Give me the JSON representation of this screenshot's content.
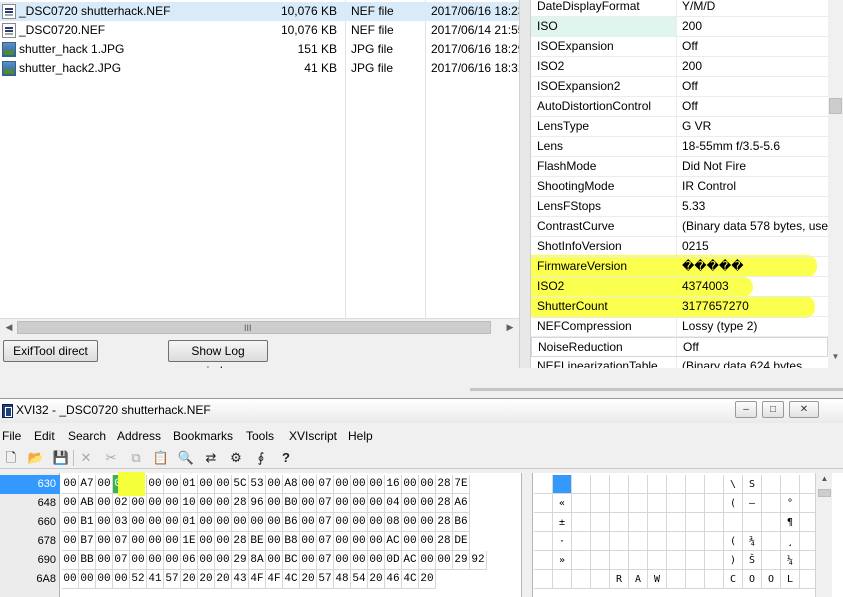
{
  "file_list": {
    "files": [
      {
        "name": "_DSC0720 shutterhack.NEF",
        "size": "10,076 KB",
        "type": "NEF file",
        "date": "2017/06/16 18:23",
        "icon": "nef-file-icon"
      },
      {
        "name": "_DSC0720.NEF",
        "size": "10,076 KB",
        "type": "NEF file",
        "date": "2017/06/14 21:55",
        "icon": "nef-file-icon"
      },
      {
        "name": "shutter_hack 1.JPG",
        "size": "151 KB",
        "type": "JPG file",
        "date": "2017/06/16 18:29",
        "icon": "jpg-file-icon"
      },
      {
        "name": "shutter_hack2.JPG",
        "size": "41 KB",
        "type": "JPG file",
        "date": "2017/06/16 18:31",
        "icon": "jpg-file-icon"
      }
    ],
    "scroll_grip": "III",
    "buttons": {
      "exiftool": "ExifTool direct",
      "show_log": "Show Log window"
    }
  },
  "exif": {
    "rows": [
      {
        "key": "DateDisplayFormat",
        "value": "Y/M/D"
      },
      {
        "key": "ISO",
        "value": "200"
      },
      {
        "key": "ISOExpansion",
        "value": "Off"
      },
      {
        "key": "ISO2",
        "value": "200"
      },
      {
        "key": "ISOExpansion2",
        "value": "Off"
      },
      {
        "key": "AutoDistortionControl",
        "value": "Off"
      },
      {
        "key": "LensType",
        "value": "G VR"
      },
      {
        "key": "Lens",
        "value": "18-55mm f/3.5-5.6"
      },
      {
        "key": "FlashMode",
        "value": "Did Not Fire"
      },
      {
        "key": "ShootingMode",
        "value": "IR Control"
      },
      {
        "key": "LensFStops",
        "value": "5.33"
      },
      {
        "key": "ContrastCurve",
        "value": "(Binary data 578 bytes, use -"
      },
      {
        "key": "ShotInfoVersion",
        "value": "0215"
      },
      {
        "key": "FirmwareVersion",
        "value": "�����"
      },
      {
        "key": "ISO2",
        "value": "4374003"
      },
      {
        "key": "ShutterCount",
        "value": "3177657270"
      },
      {
        "key": "NEFCompression",
        "value": "Lossy (type 2)"
      },
      {
        "key": "NoiseReduction",
        "value": "Off"
      },
      {
        "key": "NEFLinearizationTable",
        "value": "(Binary data 624 bytes"
      }
    ],
    "highlight_color": "#fbff3a"
  },
  "xvi32": {
    "title": "XVI32 - _DSC0720 shutterhack.NEF",
    "window_controls": {
      "minimize": "–",
      "maximize": "□",
      "close": "✕"
    },
    "menu": [
      "File",
      "Edit",
      "Search",
      "Address",
      "Bookmarks",
      "Tools",
      "XVIscript",
      "Help"
    ],
    "toolbar": [
      {
        "icon": "new-file-icon",
        "glyph": "🗋",
        "enabled": true
      },
      {
        "icon": "open-folder-icon",
        "glyph": "📂",
        "enabled": true
      },
      {
        "icon": "save-icon",
        "glyph": "💾",
        "enabled": true
      },
      {
        "icon": "delete-icon",
        "glyph": "✕",
        "enabled": false
      },
      {
        "icon": "cut-icon",
        "glyph": "✂",
        "enabled": false
      },
      {
        "icon": "copy-icon",
        "glyph": "⧉",
        "enabled": false
      },
      {
        "icon": "paste-icon",
        "glyph": "📋",
        "enabled": false
      },
      {
        "icon": "find-icon",
        "glyph": "🔍",
        "enabled": true
      },
      {
        "icon": "replace-icon",
        "glyph": "⇄",
        "enabled": true
      },
      {
        "icon": "settings-icon",
        "glyph": "⚙",
        "enabled": true
      },
      {
        "icon": "script-icon",
        "glyph": "∮",
        "enabled": true
      },
      {
        "icon": "help-icon",
        "glyph": "?",
        "enabled": true
      }
    ],
    "rows": [
      {
        "offset": "630",
        "hex": [
          "00",
          "A7",
          "00",
          "03",
          "00",
          "00",
          "00",
          "01",
          "00",
          "00",
          "5C",
          "53",
          "00",
          "A8",
          "00",
          "07",
          "00",
          "00",
          "00",
          "16",
          "00",
          "00",
          "28",
          "7E"
        ],
        "ascii": [
          "",
          "",
          "",
          "",
          "",
          "",
          "",
          "",
          "",
          "",
          "\\",
          "S",
          "",
          "",
          "",
          "",
          "",
          "",
          "",
          "",
          "",
          "",
          "(",
          "~"
        ]
      },
      {
        "offset": "648",
        "hex": [
          "00",
          "AB",
          "00",
          "02",
          "00",
          "00",
          "00",
          "10",
          "00",
          "00",
          "28",
          "96",
          "00",
          "B0",
          "00",
          "07",
          "00",
          "00",
          "00",
          "04",
          "00",
          "00",
          "28",
          "A6"
        ],
        "ascii": [
          "",
          "«",
          "",
          "",
          "",
          "",
          "",
          "",
          "",
          "",
          "(",
          "–",
          "",
          "°",
          "",
          "",
          "",
          "",
          "",
          "",
          "",
          "",
          "(",
          "¦"
        ]
      },
      {
        "offset": "660",
        "hex": [
          "00",
          "B1",
          "00",
          "03",
          "00",
          "00",
          "00",
          "01",
          "00",
          "00",
          "00",
          "00",
          "00",
          "B6",
          "00",
          "07",
          "00",
          "00",
          "00",
          "08",
          "00",
          "00",
          "28",
          "B6"
        ],
        "ascii": [
          "",
          "±",
          "",
          "",
          "",
          "",
          "",
          "",
          "",
          "",
          "",
          "",
          "",
          "¶",
          "",
          "",
          "",
          "",
          "",
          "",
          "",
          "",
          "(",
          "¶"
        ]
      },
      {
        "offset": "678",
        "hex": [
          "00",
          "B7",
          "00",
          "07",
          "00",
          "00",
          "00",
          "1E",
          "00",
          "00",
          "28",
          "BE",
          "00",
          "B8",
          "00",
          "07",
          "00",
          "00",
          "00",
          "AC",
          "00",
          "00",
          "28",
          "DE"
        ],
        "ascii": [
          "",
          "·",
          "",
          "",
          "",
          "",
          "",
          "",
          "",
          "",
          "(",
          "¾",
          "",
          "¸",
          "",
          "",
          "",
          "",
          "",
          "¬",
          "",
          "",
          "(",
          "Þ"
        ]
      },
      {
        "offset": "690",
        "hex": [
          "00",
          "BB",
          "00",
          "07",
          "00",
          "00",
          "00",
          "06",
          "00",
          "00",
          "29",
          "8A",
          "00",
          "BC",
          "00",
          "07",
          "00",
          "00",
          "00",
          "0D",
          "AC",
          "00",
          "00",
          "29",
          "92"
        ],
        "ascii": [
          "",
          "»",
          "",
          "",
          "",
          "",
          "",
          "",
          "",
          "",
          ")",
          "Š",
          "",
          "¼",
          "",
          "",
          "",
          "",
          "",
          "",
          "¬",
          "",
          ")",
          "’"
        ]
      },
      {
        "offset": "6A8",
        "hex": [
          "00",
          "00",
          "00",
          "00",
          "52",
          "41",
          "57",
          "20",
          "20",
          "20",
          "43",
          "4F",
          "4F",
          "4C",
          "20",
          "57",
          "48",
          "54",
          "20",
          "46",
          "4C",
          "20"
        ],
        "ascii": [
          "",
          "",
          "",
          "",
          "R",
          "A",
          "W",
          "",
          "",
          "",
          "C",
          "O",
          "O",
          "L",
          "",
          "W",
          "H",
          "T",
          "",
          "F",
          "L",
          ""
        ]
      }
    ],
    "selected_byte": "03",
    "byte_highlight_color": "#f5ff3a"
  }
}
